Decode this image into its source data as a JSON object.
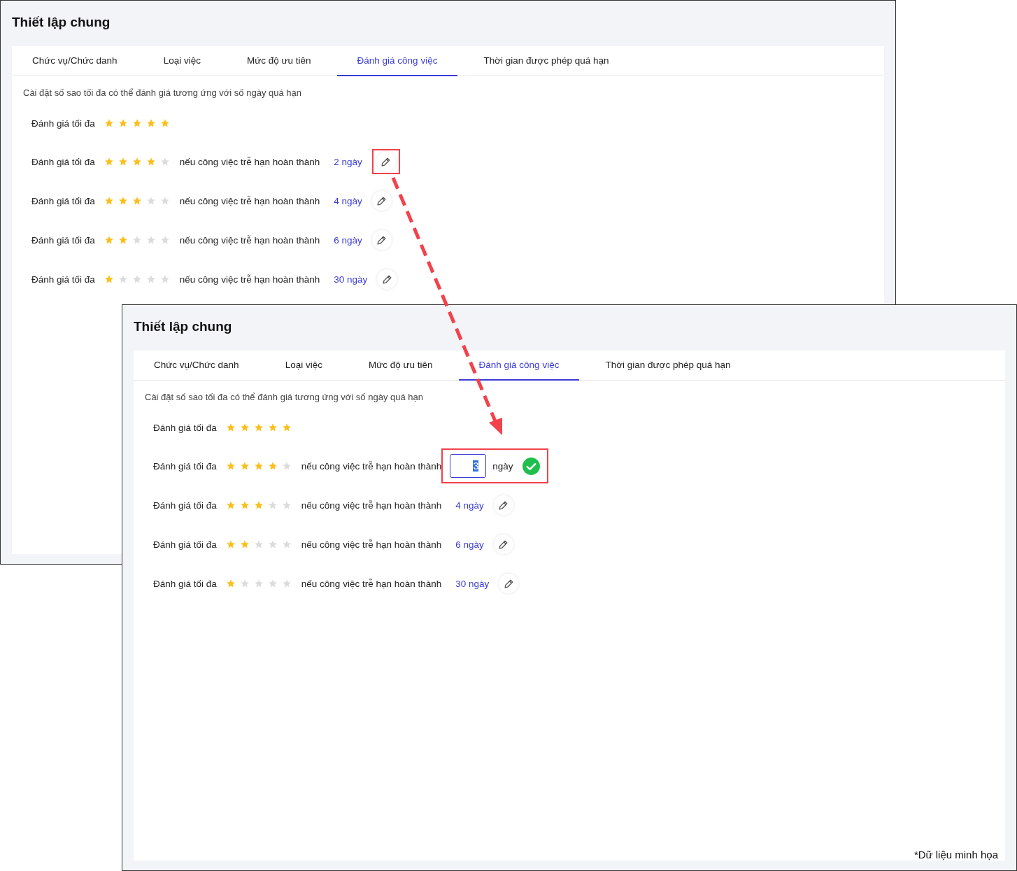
{
  "windows": [
    {
      "title": "Thiết lập chung",
      "tabs": [
        {
          "label": "Chức vụ/Chức danh",
          "selected": false
        },
        {
          "label": "Loại việc",
          "selected": false
        },
        {
          "label": "Mức độ ưu tiên",
          "selected": false
        },
        {
          "label": "Đánh giá công việc",
          "selected": true
        },
        {
          "label": "Thời gian được phép quá hạn",
          "selected": false
        }
      ],
      "description": "Cài đặt số sao tối đa có thể đánh giá tương ứng với số ngày quá hạn",
      "rows": [
        {
          "kind": "max",
          "label": "Đánh giá tối đa",
          "stars": 5
        },
        {
          "kind": "view",
          "label": "Đánh giá tối đa",
          "stars": 4,
          "condition": "nếu công việc trễ hạn hoàn thành",
          "days": "2 ngày",
          "highlighted": true
        },
        {
          "kind": "view",
          "label": "Đánh giá tối đa",
          "stars": 3,
          "condition": "nếu công việc trễ hạn hoàn thành",
          "days": "4 ngày",
          "highlighted": false
        },
        {
          "kind": "view",
          "label": "Đánh giá tối đa",
          "stars": 2,
          "condition": "nếu công việc trễ hạn hoàn thành",
          "days": "6 ngày",
          "highlighted": false
        },
        {
          "kind": "view",
          "label": "Đánh giá tối đa",
          "stars": 1,
          "condition": "nếu công việc trễ hạn hoàn thành",
          "days": "30 ngày",
          "highlighted": false
        }
      ]
    },
    {
      "title": "Thiết lập chung",
      "tabs": [
        {
          "label": "Chức vụ/Chức danh",
          "selected": false
        },
        {
          "label": "Loại việc",
          "selected": false
        },
        {
          "label": "Mức độ ưu tiên",
          "selected": false
        },
        {
          "label": "Đánh giá công việc",
          "selected": true
        },
        {
          "label": "Thời gian được phép quá hạn",
          "selected": false
        }
      ],
      "description": "Cài đặt số sao tối đa có thể đánh giá tương ứng với số ngày quá hạn",
      "rows": [
        {
          "kind": "max",
          "label": "Đánh giá tối đa",
          "stars": 5
        },
        {
          "kind": "editing",
          "label": "Đánh giá tối đa",
          "stars": 4,
          "condition": "nếu công việc trễ hạn hoàn thành",
          "value": "3",
          "unit": "ngày",
          "highlighted": true
        },
        {
          "kind": "view",
          "label": "Đánh giá tối đa",
          "stars": 3,
          "condition": "nếu công việc trễ hạn hoàn thành",
          "days": "4 ngày",
          "highlighted": false
        },
        {
          "kind": "view",
          "label": "Đánh giá tối đa",
          "stars": 2,
          "condition": "nếu công việc trễ hạn hoàn thành",
          "days": "6 ngày",
          "highlighted": false
        },
        {
          "kind": "view",
          "label": "Đánh giá tối đa",
          "stars": 1,
          "condition": "nếu công việc trễ hạn hoàn thành",
          "days": "30 ngày",
          "highlighted": false
        }
      ],
      "footnote": "*Dữ liệu minh họa"
    }
  ]
}
